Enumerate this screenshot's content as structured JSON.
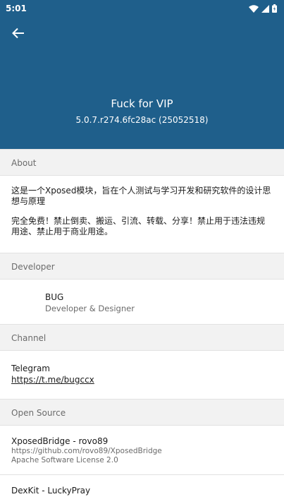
{
  "status_bar": {
    "time": "5:01"
  },
  "app": {
    "name": "Fuck for VIP",
    "version": "5.0.7.r274.6fc28ac (25052518)"
  },
  "colors": {
    "header": "#1f5f8b",
    "section_bg": "#f2f2f2"
  },
  "about": {
    "title": "About",
    "text1": "这是一个Xposed模块，旨在个人测试与学习开发和研究软件的设计思想与原理",
    "text2": "完全免费！禁止倒卖、搬运、引流、转载、分享！禁止用于违法违规用途、禁止用于商业用途。"
  },
  "developer": {
    "title": "Developer",
    "name": "BUG",
    "role": "Developer & Designer"
  },
  "channel": {
    "title": "Channel",
    "name": "Telegram",
    "link": "https://t.me/bugccx"
  },
  "open_source": {
    "title": "Open Source",
    "items": [
      {
        "name": "XposedBridge - rovo89",
        "url": "https://github.com/rovo89/XposedBridge",
        "license": "Apache Software License 2.0"
      },
      {
        "name": "DexKit - LuckyPray",
        "url": "",
        "license": ""
      }
    ]
  }
}
